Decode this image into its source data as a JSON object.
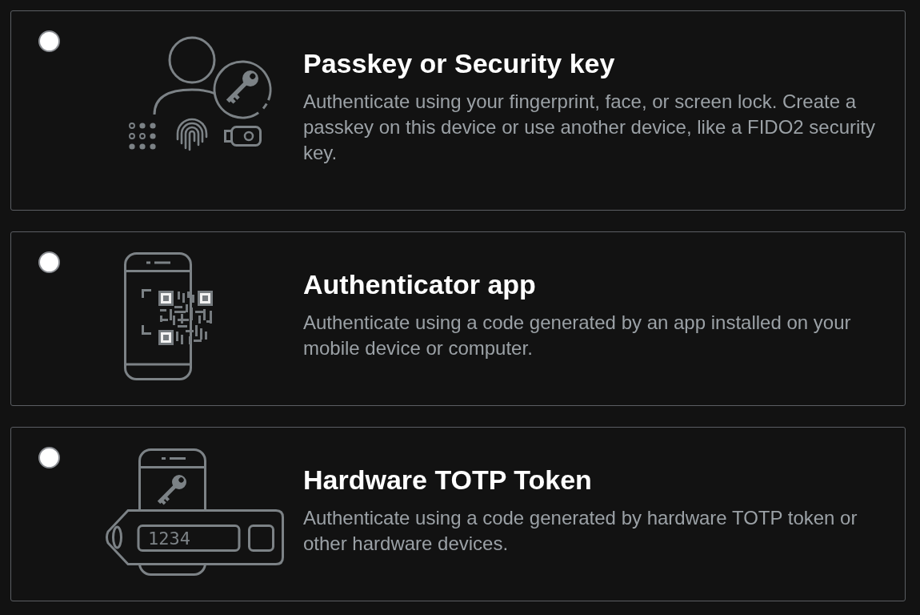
{
  "options": [
    {
      "kind": "passkey",
      "selected": false,
      "title": "Passkey or Security key",
      "description": "Authenticate using your fingerprint, face, or screen lock. Create a passkey on this device or use another device, like a FIDO2 security key."
    },
    {
      "kind": "authenticator_app",
      "selected": false,
      "title": "Authenticator app",
      "description": "Authenticate using a code generated by an app installed on your mobile device or computer."
    },
    {
      "kind": "hardware_token",
      "selected": false,
      "title": "Hardware TOTP Token",
      "description": "Authenticate using a code generated by hardware TOTP token or other hardware devices.",
      "display_code": "1234"
    }
  ]
}
